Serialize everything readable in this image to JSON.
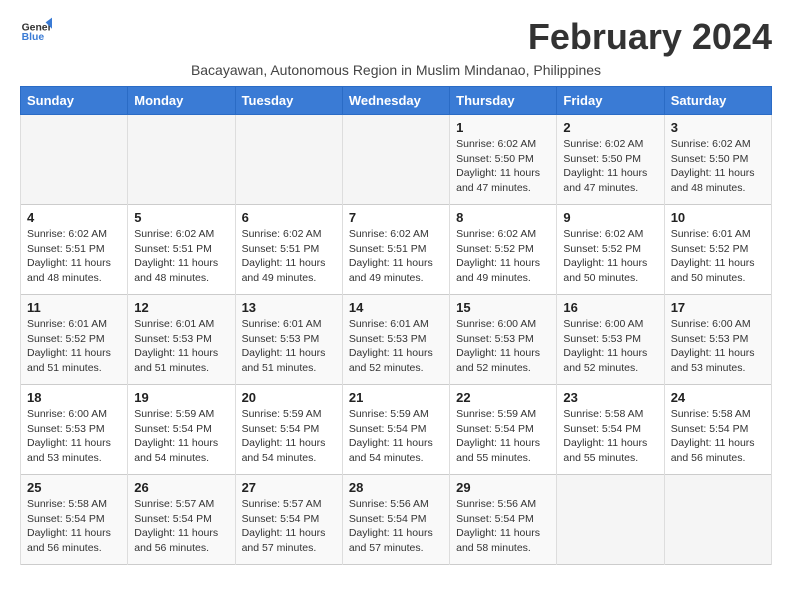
{
  "logo": {
    "line1": "General",
    "line2": "Blue"
  },
  "title": "February 2024",
  "subtitle": "Bacayawan, Autonomous Region in Muslim Mindanao, Philippines",
  "headers": [
    "Sunday",
    "Monday",
    "Tuesday",
    "Wednesday",
    "Thursday",
    "Friday",
    "Saturday"
  ],
  "weeks": [
    [
      {
        "day": "",
        "info": ""
      },
      {
        "day": "",
        "info": ""
      },
      {
        "day": "",
        "info": ""
      },
      {
        "day": "",
        "info": ""
      },
      {
        "day": "1",
        "info": "Sunrise: 6:02 AM\nSunset: 5:50 PM\nDaylight: 11 hours\nand 47 minutes."
      },
      {
        "day": "2",
        "info": "Sunrise: 6:02 AM\nSunset: 5:50 PM\nDaylight: 11 hours\nand 47 minutes."
      },
      {
        "day": "3",
        "info": "Sunrise: 6:02 AM\nSunset: 5:50 PM\nDaylight: 11 hours\nand 48 minutes."
      }
    ],
    [
      {
        "day": "4",
        "info": "Sunrise: 6:02 AM\nSunset: 5:51 PM\nDaylight: 11 hours\nand 48 minutes."
      },
      {
        "day": "5",
        "info": "Sunrise: 6:02 AM\nSunset: 5:51 PM\nDaylight: 11 hours\nand 48 minutes."
      },
      {
        "day": "6",
        "info": "Sunrise: 6:02 AM\nSunset: 5:51 PM\nDaylight: 11 hours\nand 49 minutes."
      },
      {
        "day": "7",
        "info": "Sunrise: 6:02 AM\nSunset: 5:51 PM\nDaylight: 11 hours\nand 49 minutes."
      },
      {
        "day": "8",
        "info": "Sunrise: 6:02 AM\nSunset: 5:52 PM\nDaylight: 11 hours\nand 49 minutes."
      },
      {
        "day": "9",
        "info": "Sunrise: 6:02 AM\nSunset: 5:52 PM\nDaylight: 11 hours\nand 50 minutes."
      },
      {
        "day": "10",
        "info": "Sunrise: 6:01 AM\nSunset: 5:52 PM\nDaylight: 11 hours\nand 50 minutes."
      }
    ],
    [
      {
        "day": "11",
        "info": "Sunrise: 6:01 AM\nSunset: 5:52 PM\nDaylight: 11 hours\nand 51 minutes."
      },
      {
        "day": "12",
        "info": "Sunrise: 6:01 AM\nSunset: 5:53 PM\nDaylight: 11 hours\nand 51 minutes."
      },
      {
        "day": "13",
        "info": "Sunrise: 6:01 AM\nSunset: 5:53 PM\nDaylight: 11 hours\nand 51 minutes."
      },
      {
        "day": "14",
        "info": "Sunrise: 6:01 AM\nSunset: 5:53 PM\nDaylight: 11 hours\nand 52 minutes."
      },
      {
        "day": "15",
        "info": "Sunrise: 6:00 AM\nSunset: 5:53 PM\nDaylight: 11 hours\nand 52 minutes."
      },
      {
        "day": "16",
        "info": "Sunrise: 6:00 AM\nSunset: 5:53 PM\nDaylight: 11 hours\nand 52 minutes."
      },
      {
        "day": "17",
        "info": "Sunrise: 6:00 AM\nSunset: 5:53 PM\nDaylight: 11 hours\nand 53 minutes."
      }
    ],
    [
      {
        "day": "18",
        "info": "Sunrise: 6:00 AM\nSunset: 5:53 PM\nDaylight: 11 hours\nand 53 minutes."
      },
      {
        "day": "19",
        "info": "Sunrise: 5:59 AM\nSunset: 5:54 PM\nDaylight: 11 hours\nand 54 minutes."
      },
      {
        "day": "20",
        "info": "Sunrise: 5:59 AM\nSunset: 5:54 PM\nDaylight: 11 hours\nand 54 minutes."
      },
      {
        "day": "21",
        "info": "Sunrise: 5:59 AM\nSunset: 5:54 PM\nDaylight: 11 hours\nand 54 minutes."
      },
      {
        "day": "22",
        "info": "Sunrise: 5:59 AM\nSunset: 5:54 PM\nDaylight: 11 hours\nand 55 minutes."
      },
      {
        "day": "23",
        "info": "Sunrise: 5:58 AM\nSunset: 5:54 PM\nDaylight: 11 hours\nand 55 minutes."
      },
      {
        "day": "24",
        "info": "Sunrise: 5:58 AM\nSunset: 5:54 PM\nDaylight: 11 hours\nand 56 minutes."
      }
    ],
    [
      {
        "day": "25",
        "info": "Sunrise: 5:58 AM\nSunset: 5:54 PM\nDaylight: 11 hours\nand 56 minutes."
      },
      {
        "day": "26",
        "info": "Sunrise: 5:57 AM\nSunset: 5:54 PM\nDaylight: 11 hours\nand 56 minutes."
      },
      {
        "day": "27",
        "info": "Sunrise: 5:57 AM\nSunset: 5:54 PM\nDaylight: 11 hours\nand 57 minutes."
      },
      {
        "day": "28",
        "info": "Sunrise: 5:56 AM\nSunset: 5:54 PM\nDaylight: 11 hours\nand 57 minutes."
      },
      {
        "day": "29",
        "info": "Sunrise: 5:56 AM\nSunset: 5:54 PM\nDaylight: 11 hours\nand 58 minutes."
      },
      {
        "day": "",
        "info": ""
      },
      {
        "day": "",
        "info": ""
      }
    ]
  ]
}
